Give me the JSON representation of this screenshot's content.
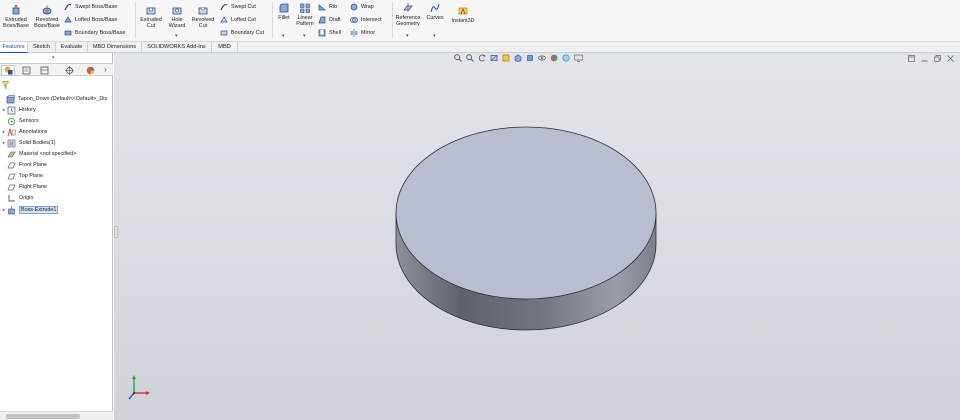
{
  "ribbon": {
    "extruded_boss": "Extruded Boss/Base",
    "revolved_boss": "Revolved Boss/Base",
    "swept_boss": "Swept Boss/Base",
    "lofted_boss": "Lofted Boss/Base",
    "boundary_boss": "Boundary Boss/Base",
    "extruded_cut": "Extruded Cut",
    "hole_wizard": "Hole Wizard",
    "revolved_cut": "Revolved Cut",
    "swept_cut": "Swept Cut",
    "lofted_cut": "Lofted Cut",
    "boundary_cut": "Boundary Cut",
    "fillet": "Fillet",
    "linear_pattern": "Linear Pattern",
    "rib": "Rib",
    "draft": "Draft",
    "shell": "Shell",
    "wrap": "Wrap",
    "intersect": "Intersect",
    "mirror": "Mirror",
    "reference_geometry": "Reference Geometry",
    "curves": "Curves",
    "instant3d": "Instant3D",
    "dropdown_mark": "▾"
  },
  "tabs": [
    "Features",
    "Sketch",
    "Evaluate",
    "MBD Dimensions",
    "SOLIDWORKS Add-Ins",
    "MBD"
  ],
  "panel": {
    "collapse_arrow": "▴",
    "more_arrow": "›",
    "tree": [
      {
        "label": "Tapon_Down  (Default<<Default>_Dis",
        "icon": "part-icon",
        "expand": ""
      },
      {
        "label": "History",
        "icon": "history-icon",
        "expand": "▸"
      },
      {
        "label": "Sensors",
        "icon": "sensors-icon",
        "expand": ""
      },
      {
        "label": "Annotations",
        "icon": "annotations-icon",
        "expand": "▸"
      },
      {
        "label": "Solid Bodies(1)",
        "icon": "solid-bodies-icon",
        "expand": "▸"
      },
      {
        "label": "Material <not specified>",
        "icon": "material-icon",
        "expand": ""
      },
      {
        "label": "Front Plane",
        "icon": "plane-icon",
        "expand": ""
      },
      {
        "label": "Top Plane",
        "icon": "plane-icon",
        "expand": ""
      },
      {
        "label": "Right Plane",
        "icon": "plane-icon",
        "expand": ""
      },
      {
        "label": "Origin",
        "icon": "origin-icon",
        "expand": ""
      },
      {
        "label": "Boss-Extrude1",
        "icon": "extrude-feature-icon",
        "expand": "▸"
      }
    ]
  },
  "colors": {
    "accent": "#1b4f9c",
    "selection": "#cfe3fb",
    "disk_top": "#b9bdd0",
    "disk_side": "#6f747d",
    "viewport_top": "#e2e5ea",
    "viewport_bottom": "#cfd3d9"
  }
}
